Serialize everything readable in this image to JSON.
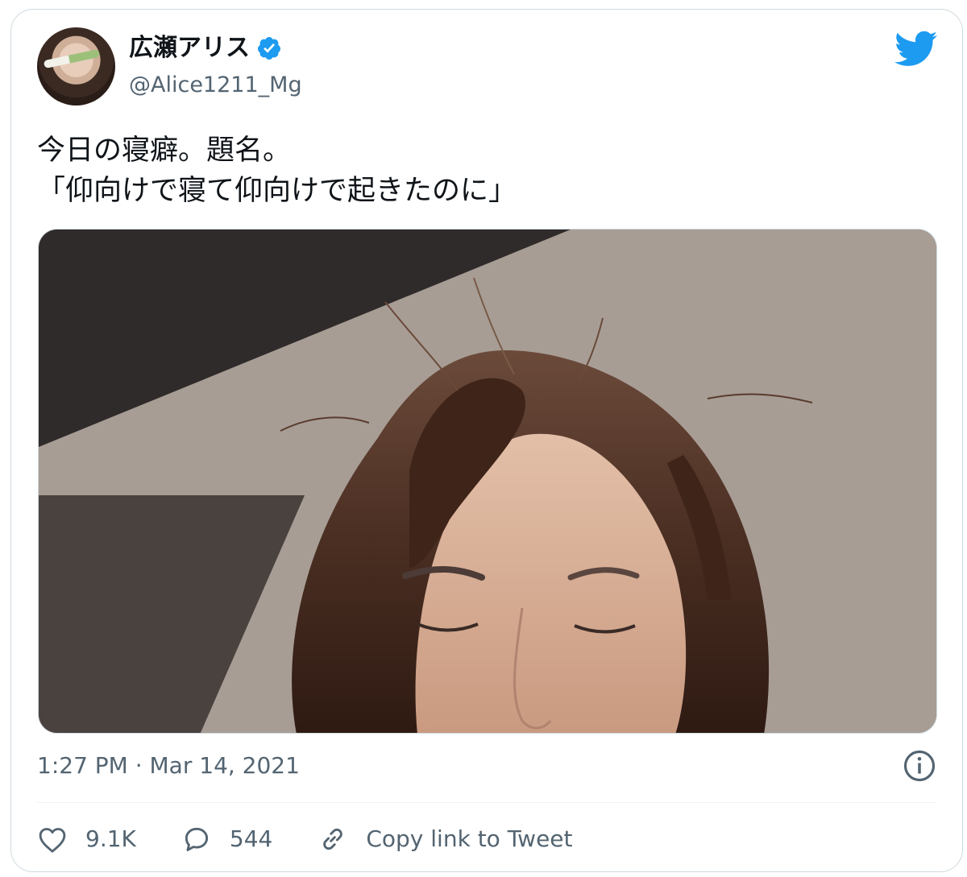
{
  "author": {
    "display_name": "広瀬アリス",
    "handle": "@Alice1211_Mg",
    "verified_icon": "verified-badge-icon",
    "avatar_icon": "profile-avatar"
  },
  "platform_icon": "twitter-bird-icon",
  "tweet": {
    "text": "今日の寝癖。題名。\n「仰向けで寝て仰向けで起きたのに」",
    "image_icon": "photo-of-messy-bedhead-hair",
    "timestamp": "1:27 PM · Mar 14, 2021"
  },
  "actions": {
    "like_count": "9.1K",
    "reply_count": "544",
    "copy_link_label": "Copy link to Tweet"
  },
  "colors": {
    "accent": "#1d9bf0",
    "secondary_text": "#536471",
    "border": "#cfd9de"
  }
}
